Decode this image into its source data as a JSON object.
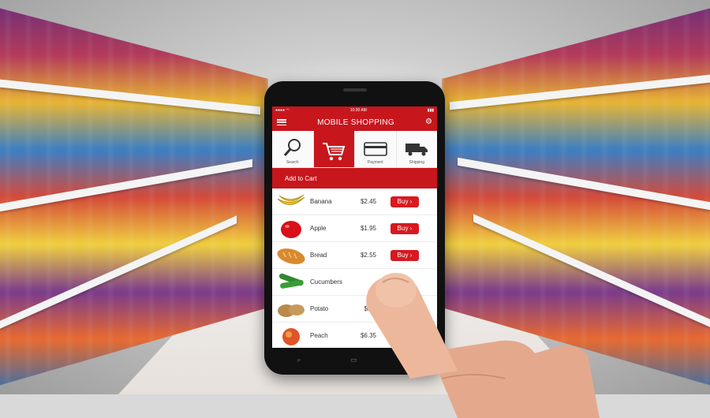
{
  "app": {
    "status": {
      "left": "●●●● ◠",
      "center": "10:30 AM",
      "right": "▮▮▮"
    },
    "title": "MOBILE SHOPPING"
  },
  "tabs": [
    {
      "label": "Search",
      "icon": "magnifier-icon"
    },
    {
      "label": "",
      "icon": "cart-icon"
    },
    {
      "label": "Payment",
      "icon": "credit-card-icon"
    },
    {
      "label": "Shipping",
      "icon": "truck-icon"
    }
  ],
  "cart_header": "Add to Cart",
  "items": [
    {
      "name": "Banana",
      "price": "$2.45",
      "buy": "Buy ›"
    },
    {
      "name": "Apple",
      "price": "$1.95",
      "buy": "Buy ›"
    },
    {
      "name": "Bread",
      "price": "$2.55",
      "buy": "Buy ›"
    },
    {
      "name": "Cucumbers",
      "price": "",
      "buy": ""
    },
    {
      "name": "Potato",
      "price": "$3.",
      "buy": ""
    },
    {
      "name": "Peach",
      "price": "$6.35",
      "buy": ""
    }
  ],
  "colors": {
    "accent": "#c8161d",
    "button": "#d81920"
  }
}
